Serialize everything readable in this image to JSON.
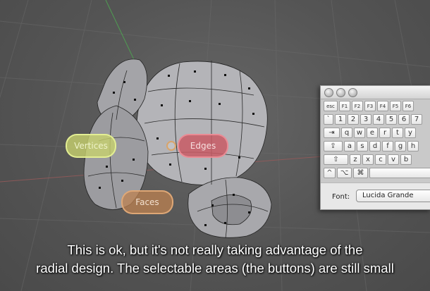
{
  "pie_menu": {
    "vertices_label": "Vertices",
    "edges_label": "Edges",
    "faces_label": "Faces"
  },
  "keyboard_viewer": {
    "function_row": [
      "esc",
      "F1",
      "F2",
      "F3",
      "F4",
      "F5",
      "F6"
    ],
    "number_row": [
      "`",
      "1",
      "2",
      "3",
      "4",
      "5",
      "6",
      "7"
    ],
    "top_row": [
      "⇥",
      "q",
      "w",
      "e",
      "r",
      "t",
      "y"
    ],
    "home_row": [
      "⇪",
      "a",
      "s",
      "d",
      "f",
      "g",
      "h"
    ],
    "bottom_row": [
      "⇧",
      "z",
      "x",
      "c",
      "v",
      "b"
    ],
    "modifier_row": [
      "^",
      "⌥",
      "⌘"
    ],
    "font_label": "Font:",
    "font_value": "Lucida Grande"
  },
  "caption": {
    "line1": "This is ok, but it's not really taking advantage of the",
    "line2": "radial design. The selectable areas (the buttons) are still small"
  }
}
